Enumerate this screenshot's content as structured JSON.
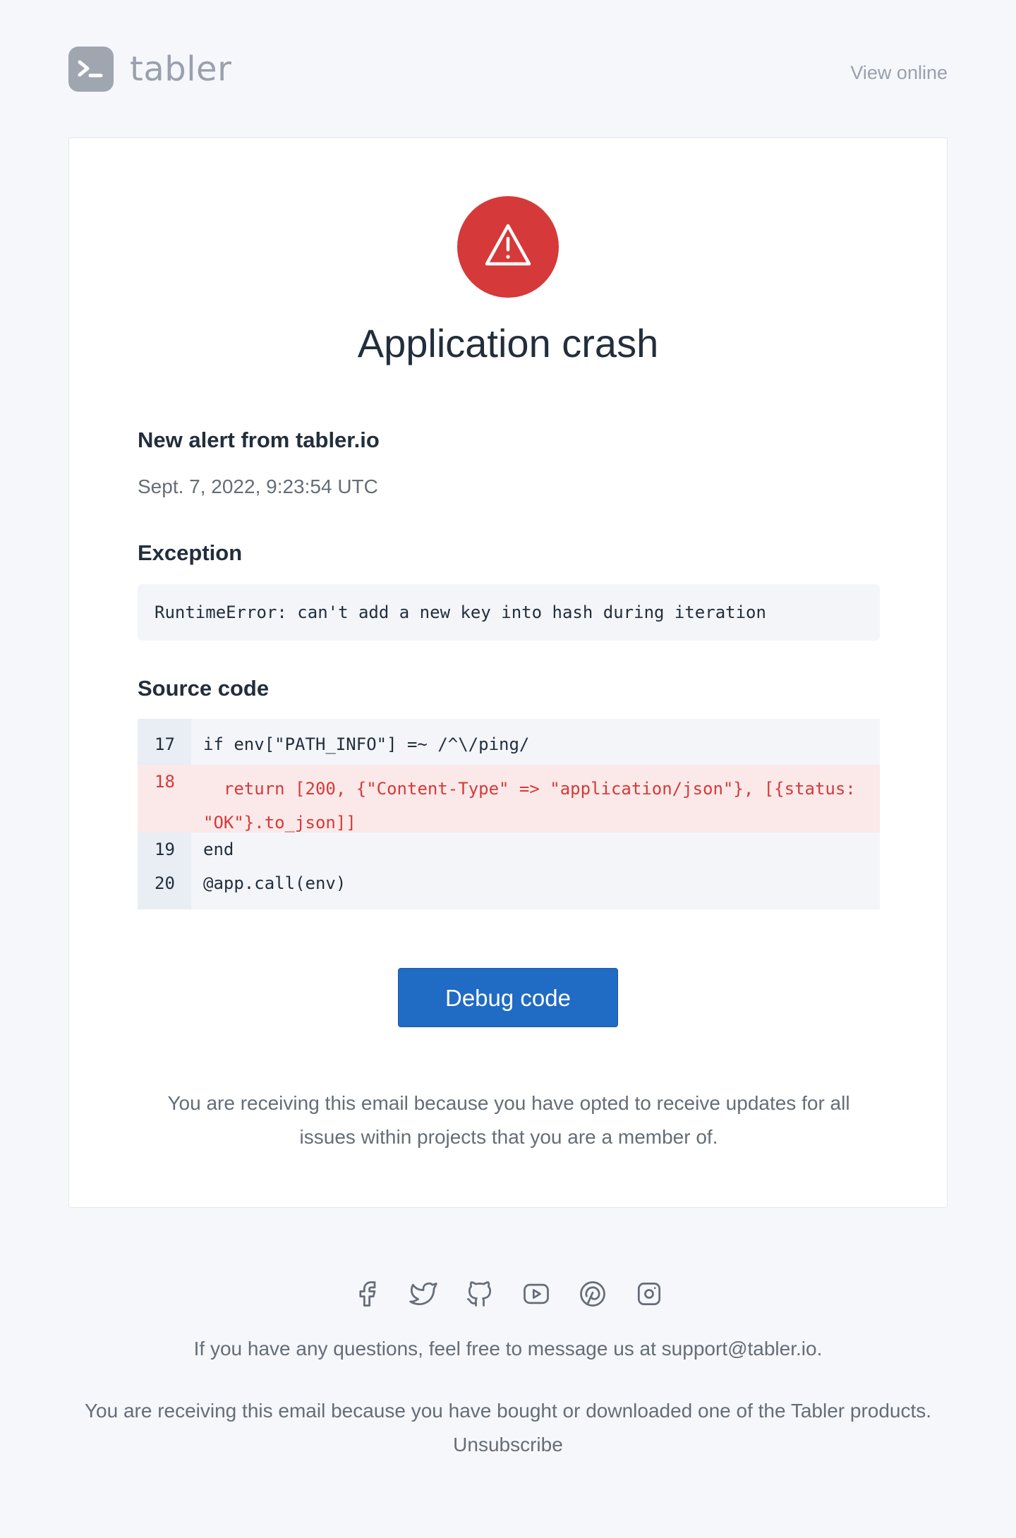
{
  "header": {
    "brand": "tabler",
    "view_online": "View online"
  },
  "alert": {
    "icon": "alert-triangle-icon",
    "color": "#d63939",
    "title": "Application crash"
  },
  "details": {
    "heading": "New alert from tabler.io",
    "timestamp": "Sept. 7, 2022, 9:23:54 UTC",
    "exception_label": "Exception",
    "exception_text": "RuntimeError: can't add a new key into hash during iteration",
    "source_label": "Source code"
  },
  "code_lines": [
    {
      "num": "17",
      "text": "if env[\"PATH_INFO\"] =~ /^\\/ping/",
      "highlight": false
    },
    {
      "num": "18",
      "text": "  return [200, {\"Content-Type\" => \"application/json\"}, [{status: \"OK\"}.to_json]]",
      "highlight": true
    },
    {
      "num": "19",
      "text": "end",
      "highlight": false
    },
    {
      "num": "20",
      "text": "@app.call(env)",
      "highlight": false
    }
  ],
  "action": {
    "button_label": "Debug code",
    "color": "#206bc4"
  },
  "notice": "You are receiving this email because you have opted to receive updates for all issues within projects that you are a member of.",
  "footer": {
    "social_icons": [
      "facebook-icon",
      "twitter-icon",
      "github-icon",
      "youtube-icon",
      "pinterest-icon",
      "instagram-icon"
    ],
    "questions": "If you have any questions, feel free to message us at support@tabler.io.",
    "reason": "You are receiving this email because you have bought or downloaded one of the Tabler products.",
    "unsubscribe": "Unsubscribe"
  }
}
